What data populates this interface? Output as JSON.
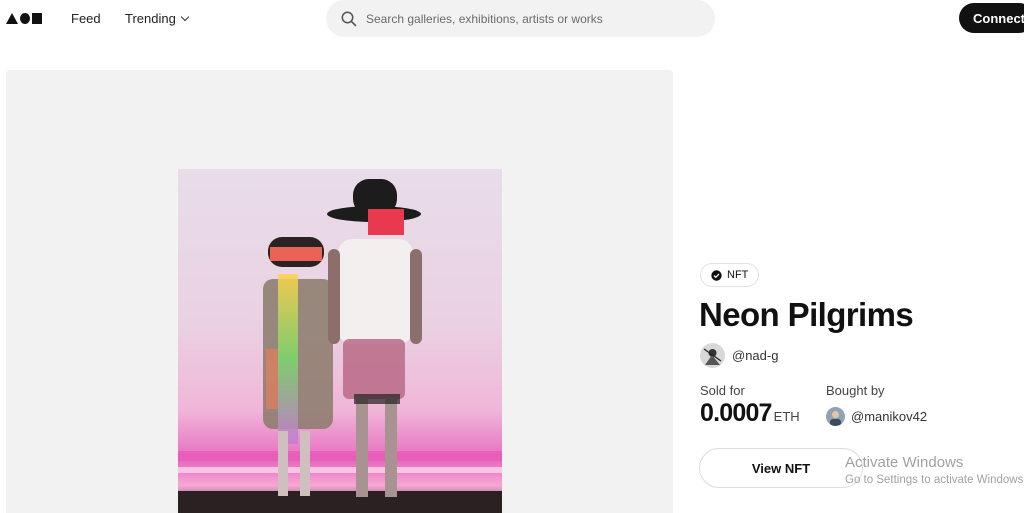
{
  "header": {
    "logo_label": "AOM",
    "nav": {
      "feed": "Feed",
      "trending": "Trending"
    },
    "search": {
      "placeholder": "Search galleries, exhibitions, artists or works"
    },
    "connect_label": "Connect"
  },
  "artwork": {
    "badge_label": "NFT",
    "title": "Neon Pilgrims",
    "creator": "@nad-g",
    "sold": {
      "label": "Sold for",
      "value": "0.0007",
      "unit": "ETH"
    },
    "bought": {
      "label": "Bought by",
      "buyer": "@manikov42"
    },
    "view_button": "View NFT"
  },
  "watermark": {
    "title": "Activate Windows",
    "subtitle": "Go to Settings to activate Windows."
  },
  "colors": {
    "accent": "#111111",
    "search_bg": "#f2f2f2",
    "panel_bg": "#f2f2f2",
    "artwork_pink": "#e9a9cf",
    "artwork_magenta": "#e04bb0"
  },
  "icons": {
    "search": "search-icon",
    "badge": "verified-badge-icon",
    "trending": "chevron-down-icon"
  }
}
